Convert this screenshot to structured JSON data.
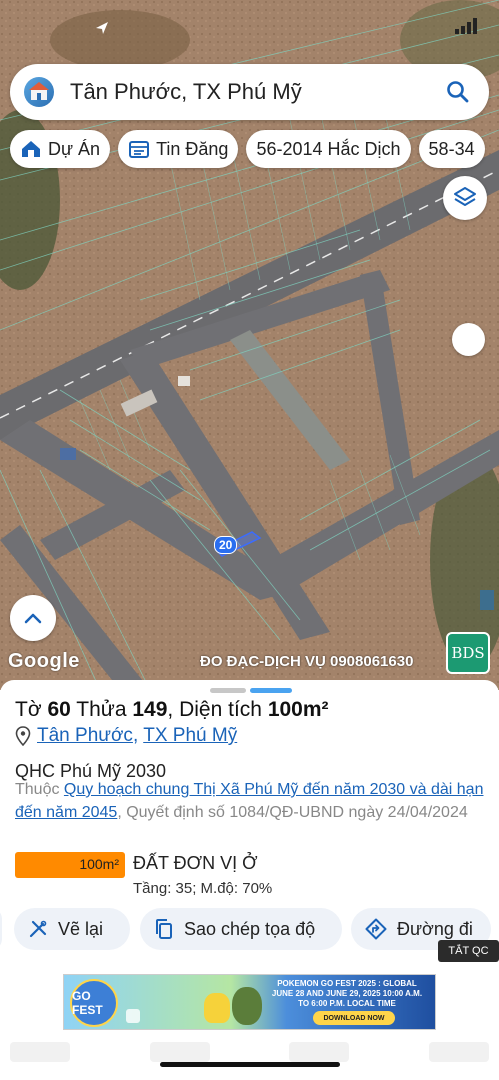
{
  "search": {
    "query": "Tân Phước, TX Phú Mỹ"
  },
  "chips": [
    {
      "label": "Dự Án",
      "icon": "house-icon"
    },
    {
      "label": "Tin Đăng",
      "icon": "listing-icon"
    },
    {
      "label": "56-2014 Hắc Dịch",
      "icon": ""
    },
    {
      "label": "58-34",
      "icon": ""
    }
  ],
  "map": {
    "lot_label": "20",
    "attribution": "Google",
    "watermark": "ĐO ĐẠC-DỊCH VỤ 0908061630",
    "brand_logo_text": "BDS"
  },
  "parcel": {
    "sheet_prefix": "Tờ",
    "sheet_no": "60",
    "lot_prefix": "Thửa",
    "lot_no": "149",
    "area_prefix": ", Diện tích",
    "area": "100m²",
    "ward": "Tân Phước",
    "town": "TX Phú Mỹ",
    "plan_name": "QHC Phú Mỹ 2030",
    "plan_desc_prefix": "Thuộc",
    "plan_link": "Quy hoạch chung Thị Xã Phú Mỹ đến năm 2030 và dài hạn đến năm 2045",
    "plan_desc_suffix": ", Quyết định số 1084/QĐ-UBND ngày 24/04/2024",
    "area_badge": "100m²",
    "land_type": "ĐẤT ĐƠN VỊ Ở",
    "land_specs": "Tầng: 35; M.độ: 70%"
  },
  "actions": {
    "redraw": "Vẽ lại",
    "copy_coords": "Sao chép tọa độ",
    "directions": "Đường đi"
  },
  "ad": {
    "close_label": "TẮT QC",
    "logo_text": "GO FEST",
    "title": "POKEMON GO FEST 2025 : GLOBAL JUNE 28 AND JUNE 29, 2025 10:00 A.M. TO 6:00 P.M. LOCAL TIME",
    "cta": "DOWNLOAD NOW"
  },
  "colors": {
    "accent_blue": "#1a63b8",
    "area_badge": "#ff8a00",
    "brand_green": "#1c9a72"
  }
}
